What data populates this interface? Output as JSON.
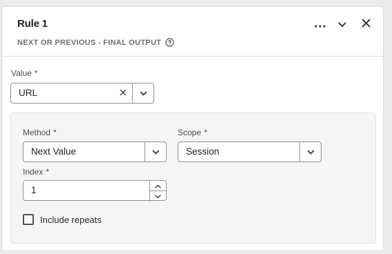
{
  "header": {
    "title": "Rule 1",
    "subtitle": "NEXT OR PREVIOUS - FINAL OUTPUT",
    "actions": {
      "more": "more-icon",
      "collapse": "chevron-down-icon",
      "close": "close-icon"
    }
  },
  "value_field": {
    "label": "Value",
    "required_mark": "*",
    "value": "URL"
  },
  "method_field": {
    "label": "Method",
    "required_mark": "*",
    "value": "Next Value"
  },
  "scope_field": {
    "label": "Scope",
    "required_mark": "*",
    "value": "Session"
  },
  "index_field": {
    "label": "Index",
    "required_mark": "*",
    "value": "1"
  },
  "include_repeats": {
    "label": "Include repeats",
    "checked": false
  },
  "colors": {
    "border": "#909090",
    "panel_bg": "#f5f5f5",
    "text": "#222222"
  }
}
